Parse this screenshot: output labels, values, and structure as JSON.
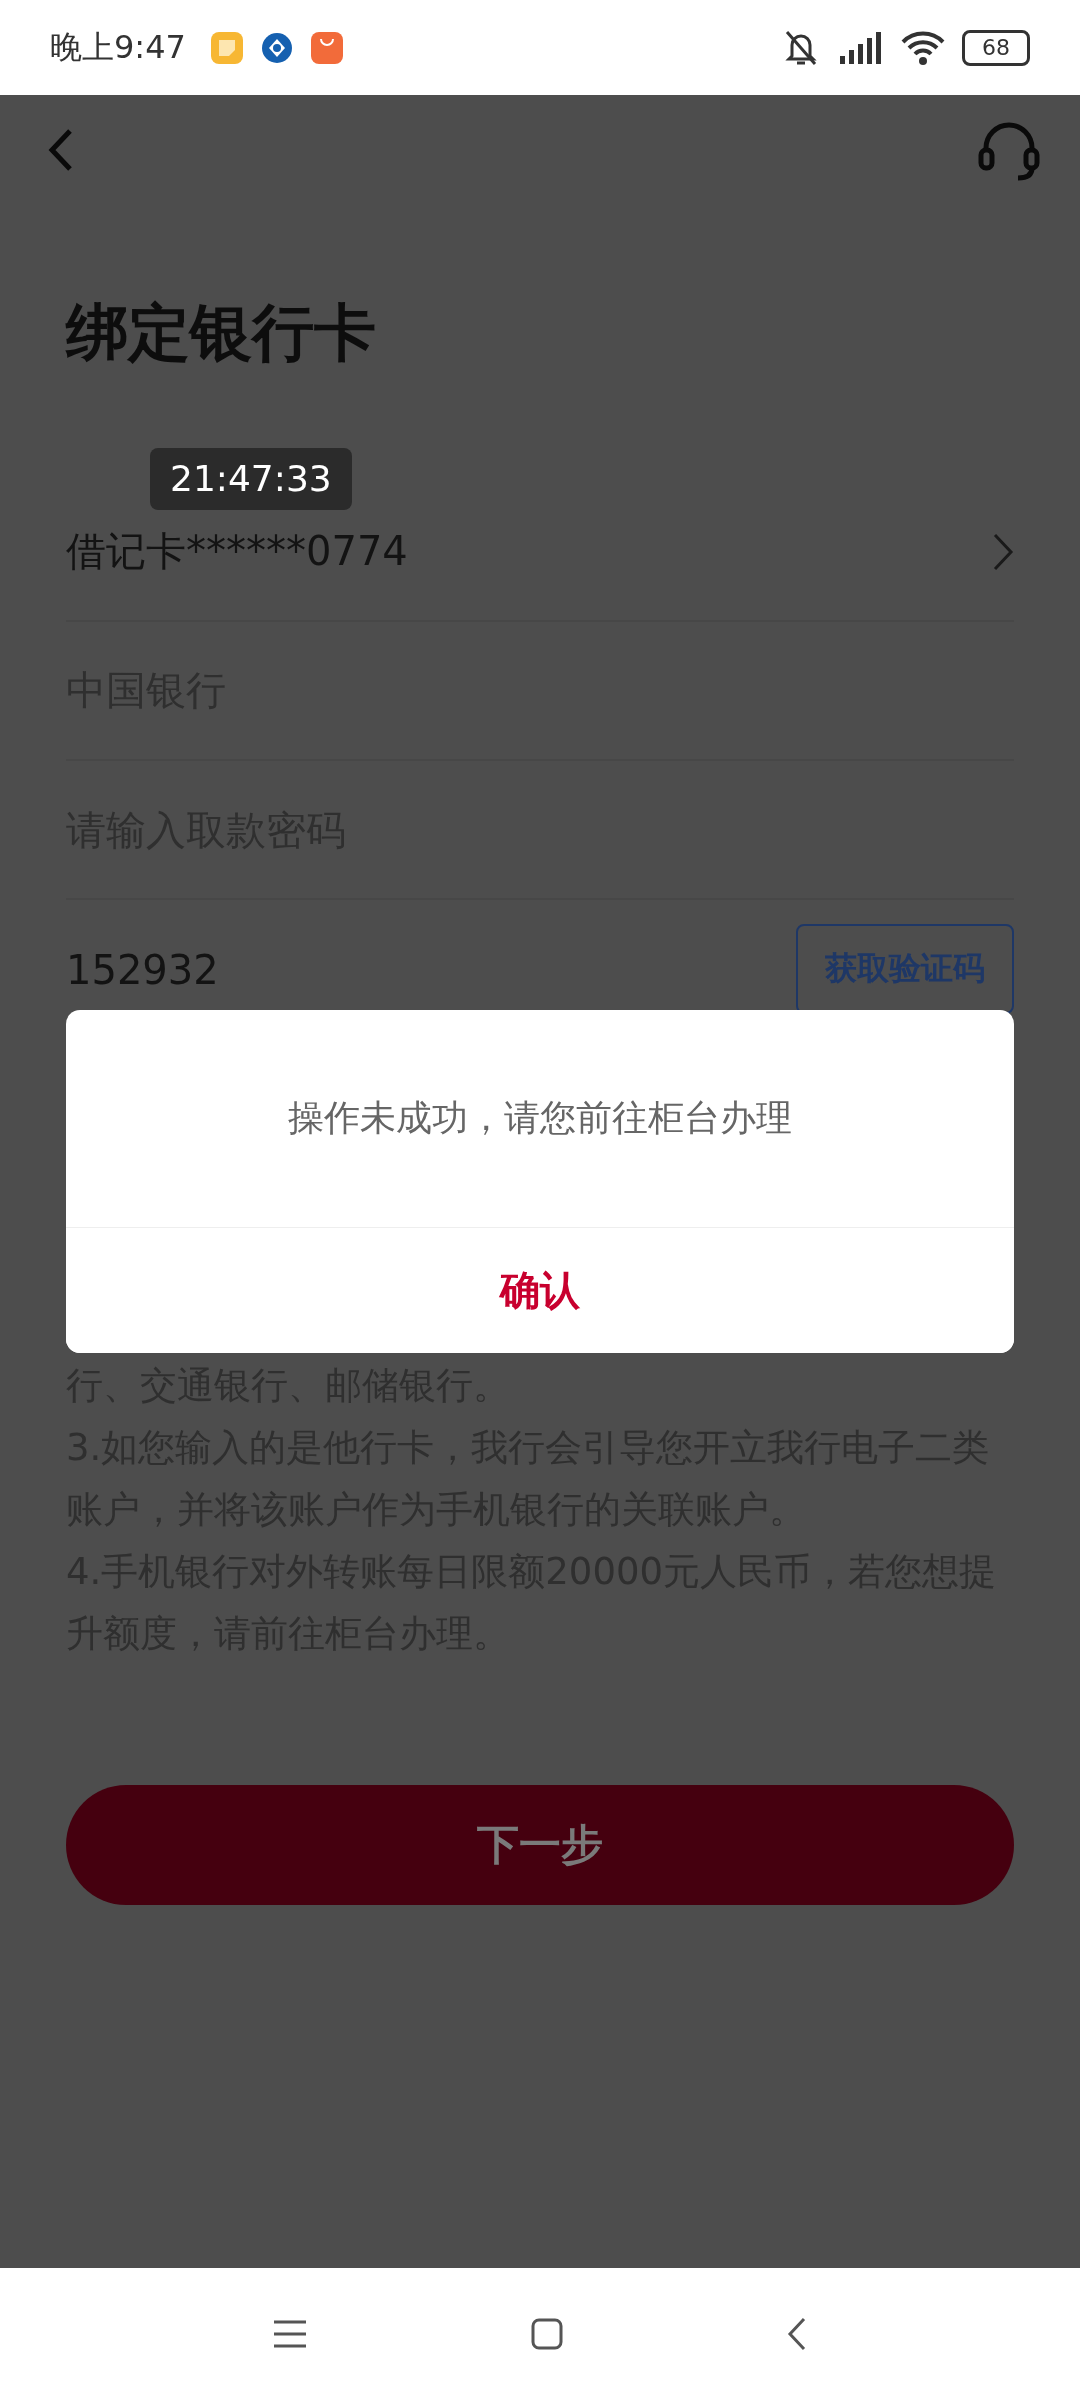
{
  "status_bar": {
    "time": "晚上9:47",
    "battery": "68"
  },
  "title": "绑定银行卡",
  "timestamp_overlay": "21:47:33",
  "form": {
    "card": "借记卡******0774",
    "bank": "中国银行",
    "password": {
      "placeholder": "请输入取款密码"
    },
    "code": {
      "value": "152932",
      "button": "获取验证码"
    }
  },
  "notes": [
    "行、交通银行、邮储银行。",
    "3.如您输入的是他行卡，我行会引导您开立我行电子二类账户，并将该账户作为手机银行的关联账户。",
    "4.手机银行对外转账每日限额20000元人民币，若您想提升额度，请前往柜台办理。"
  ],
  "next_button": {
    "label": "下一步",
    "disabled": true
  },
  "dialog": {
    "message": "操作未成功，请您前往柜台办理",
    "confirm": "确认"
  }
}
